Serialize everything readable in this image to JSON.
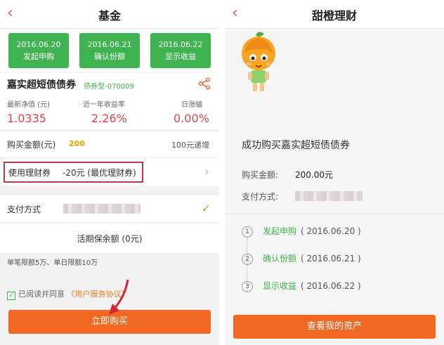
{
  "left": {
    "nav": {
      "title": "基金"
    },
    "steps": [
      {
        "date": "2016.06.20",
        "label": "发起申购"
      },
      {
        "date": "2016.06.21",
        "label": "确认份额"
      },
      {
        "date": "2016.06.22",
        "label": "显示收益"
      }
    ],
    "fund": {
      "name": "嘉实超短债债券",
      "code": "债券型-070009",
      "metrics": [
        {
          "label": "最新净值 (元)",
          "value": "1.0335"
        },
        {
          "label": "近一年收益率",
          "value": "2.26%"
        },
        {
          "label": "日涨幅",
          "value": "0.00%"
        }
      ]
    },
    "buy": {
      "label": "购买金额(元)",
      "amount": "200",
      "increment": "100元递增"
    },
    "coupon": {
      "label": "使用理财券",
      "value": "-20元 (最优理财券)"
    },
    "payment": {
      "label": "支付方式"
    },
    "wallet": {
      "label": "活期保余额 (0元)"
    },
    "limit": "单笔限额5万、单日限额10万",
    "agreement": {
      "prefix": "已阅读并同意",
      "link": "《用户服务协议》"
    },
    "button": "立即购买"
  },
  "right": {
    "nav": {
      "title": "甜橙理财"
    },
    "success": "成功购买嘉实超短债债券",
    "amount": {
      "label": "购买金额:",
      "value": "200.00元"
    },
    "payment": {
      "label": "支付方式:"
    },
    "timeline": [
      {
        "num": "1",
        "label": "发起申购",
        "date": "( 2016.06.20 )"
      },
      {
        "num": "2",
        "label": "确认份额",
        "date": "( 2016.06.21 )"
      },
      {
        "num": "3",
        "label": "显示收益",
        "date": "( 2016.06.22 )"
      }
    ],
    "button": "查看我的资产"
  },
  "colors": {
    "accent": "#f26822",
    "green": "#3fb34f",
    "red": "#e8434a",
    "highlight_box": "#b43b47"
  }
}
